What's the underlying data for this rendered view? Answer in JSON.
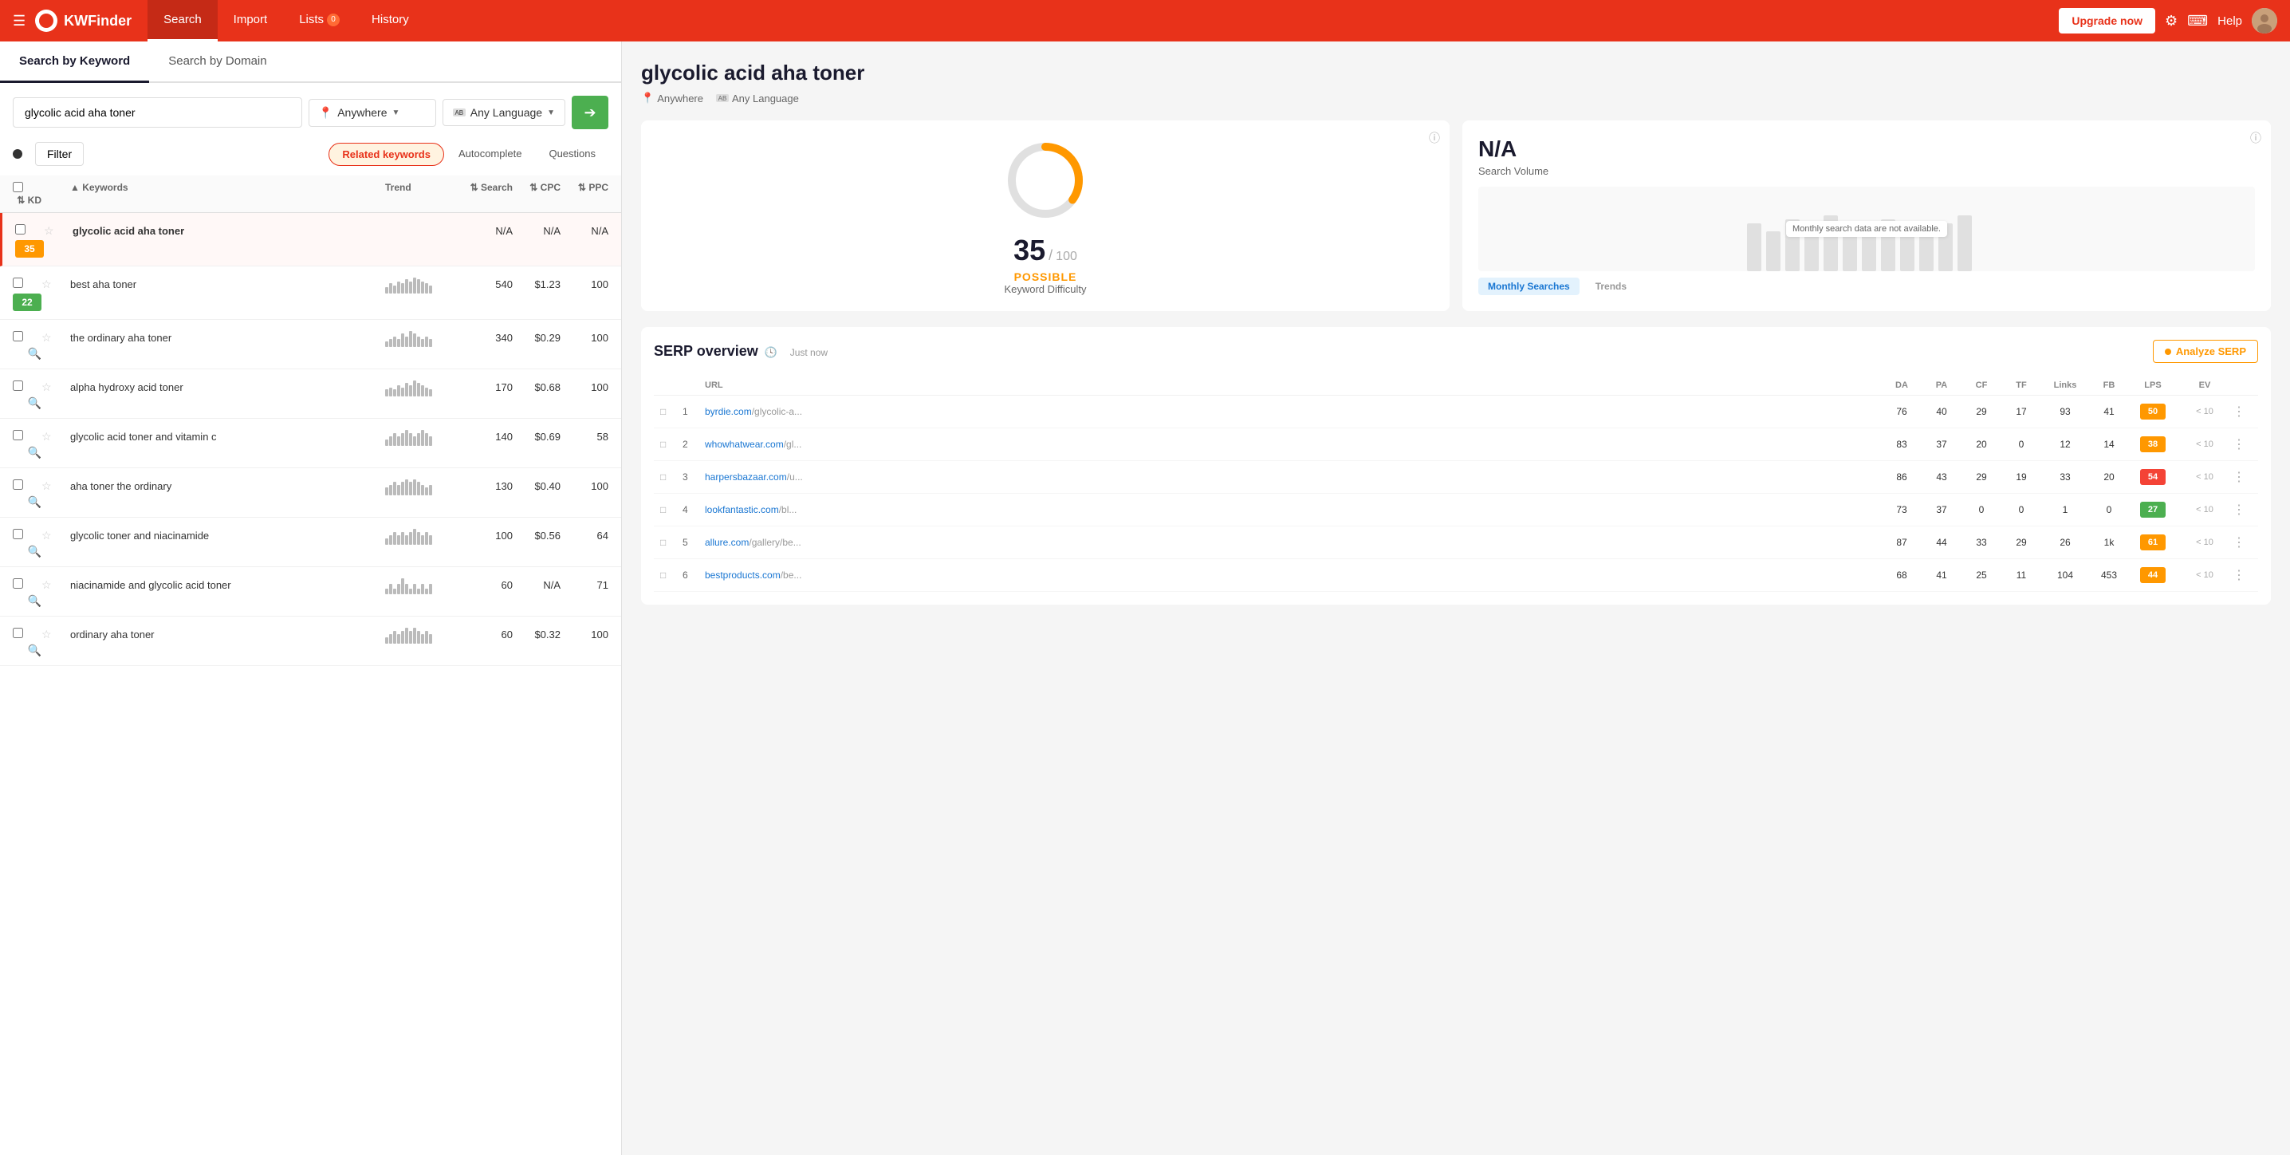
{
  "nav": {
    "logo_text": "KWFinder",
    "tabs": [
      {
        "label": "Search",
        "active": true
      },
      {
        "label": "Import",
        "active": false
      },
      {
        "label": "Lists",
        "badge": "0",
        "active": false
      },
      {
        "label": "History",
        "active": false
      }
    ],
    "upgrade_btn": "Upgrade now",
    "help_label": "Help"
  },
  "left": {
    "search_tab_keyword": "Search by Keyword",
    "search_tab_domain": "Search by Domain",
    "search_value": "glycolic acid aha toner",
    "location_label": "Anywhere",
    "language_label": "Any Language",
    "filter_label": "Filter",
    "kw_tabs": [
      {
        "label": "Related keywords",
        "active": true
      },
      {
        "label": "Autocomplete",
        "active": false
      },
      {
        "label": "Questions",
        "active": false
      }
    ],
    "table_headers": {
      "keyword": "Keywords",
      "trend": "Trend",
      "search": "Search",
      "cpc": "CPC",
      "ppc": "PPC",
      "kd": "KD"
    },
    "keywords": [
      {
        "keyword": "glycolic acid aha toner",
        "bold": true,
        "search": "N/A",
        "cpc": "N/A",
        "ppc": "N/A",
        "kd": 35,
        "kd_color": "orange",
        "selected": true,
        "trend": []
      },
      {
        "keyword": "best aha toner",
        "bold": false,
        "search": "540",
        "cpc": "$1.23",
        "ppc": "100",
        "kd": 22,
        "kd_color": "green",
        "selected": false,
        "trend": [
          3,
          5,
          4,
          6,
          5,
          7,
          6,
          8,
          7,
          6,
          5,
          4
        ]
      },
      {
        "keyword": "the ordinary aha toner",
        "bold": false,
        "search": "340",
        "cpc": "$0.29",
        "ppc": "100",
        "kd": null,
        "kd_color": null,
        "selected": false,
        "trend": [
          2,
          3,
          4,
          3,
          5,
          4,
          6,
          5,
          4,
          3,
          4,
          3
        ]
      },
      {
        "keyword": "alpha hydroxy acid toner",
        "bold": false,
        "search": "170",
        "cpc": "$0.68",
        "ppc": "100",
        "kd": null,
        "kd_color": null,
        "selected": false,
        "trend": [
          3,
          4,
          3,
          5,
          4,
          6,
          5,
          7,
          6,
          5,
          4,
          3
        ]
      },
      {
        "keyword": "glycolic acid toner and vitamin c",
        "bold": false,
        "search": "140",
        "cpc": "$0.69",
        "ppc": "58",
        "kd": null,
        "kd_color": null,
        "selected": false,
        "trend": [
          2,
          3,
          4,
          3,
          4,
          5,
          4,
          3,
          4,
          5,
          4,
          3
        ]
      },
      {
        "keyword": "aha toner the ordinary",
        "bold": false,
        "search": "130",
        "cpc": "$0.40",
        "ppc": "100",
        "kd": null,
        "kd_color": null,
        "selected": false,
        "trend": [
          3,
          4,
          5,
          4,
          5,
          6,
          5,
          6,
          5,
          4,
          3,
          4
        ]
      },
      {
        "keyword": "glycolic toner and niacinamide",
        "bold": false,
        "search": "100",
        "cpc": "$0.56",
        "ppc": "64",
        "kd": null,
        "kd_color": null,
        "selected": false,
        "trend": [
          2,
          3,
          4,
          3,
          4,
          3,
          4,
          5,
          4,
          3,
          4,
          3
        ]
      },
      {
        "keyword": "niacinamide and glycolic acid toner",
        "bold": false,
        "search": "60",
        "cpc": "N/A",
        "ppc": "71",
        "kd": null,
        "kd_color": null,
        "selected": false,
        "trend": [
          1,
          2,
          1,
          2,
          3,
          2,
          1,
          2,
          1,
          2,
          1,
          2
        ]
      },
      {
        "keyword": "ordinary aha toner",
        "bold": false,
        "search": "60",
        "cpc": "$0.32",
        "ppc": "100",
        "kd": null,
        "kd_color": null,
        "selected": false,
        "trend": [
          2,
          3,
          4,
          3,
          4,
          5,
          4,
          5,
          4,
          3,
          4,
          3
        ]
      }
    ]
  },
  "right": {
    "keyword_title": "glycolic acid aha toner",
    "location": "Anywhere",
    "language": "Any Language",
    "kd_value": "35",
    "kd_max": "100",
    "kd_label": "POSSIBLE",
    "kd_sublabel": "Keyword Difficulty",
    "sv_value": "N/A",
    "sv_sublabel": "Search Volume",
    "sv_unavailable": "Monthly search data are not available.",
    "sv_tab_monthly": "Monthly Searches",
    "sv_tab_trends": "Trends",
    "serp_title": "SERP overview",
    "serp_time": "Just now",
    "analyze_btn": "Analyze SERP",
    "serp_headers": [
      "",
      "",
      "URL",
      "DA",
      "PA",
      "CF",
      "TF",
      "Links",
      "FB",
      "LPS",
      "EV",
      ""
    ],
    "serp_rows": [
      {
        "num": 1,
        "url": "byrdie.com",
        "url_path": "/glycolic-a...",
        "da": 76,
        "pa": 40,
        "cf": 29,
        "tf": 17,
        "links": 93,
        "fb": 41,
        "lps": 50,
        "lps_color": "orange",
        "ev": "< 10"
      },
      {
        "num": 2,
        "url": "whowhatwear.com",
        "url_path": "/gl...",
        "da": 83,
        "pa": 37,
        "cf": 20,
        "tf": 0,
        "links": 12,
        "fb": 14,
        "lps": 38,
        "lps_color": "orange",
        "ev": "< 10"
      },
      {
        "num": 3,
        "url": "harpersbazaar.com",
        "url_path": "/u...",
        "da": 86,
        "pa": 43,
        "cf": 29,
        "tf": 19,
        "links": 33,
        "fb": 20,
        "lps": 54,
        "lps_color": "red",
        "ev": "< 10"
      },
      {
        "num": 4,
        "url": "lookfantastic.com",
        "url_path": "/bl...",
        "da": 73,
        "pa": 37,
        "cf": 0,
        "tf": 0,
        "links": 1,
        "fb": 0,
        "lps": 27,
        "lps_color": "green",
        "ev": "< 10"
      },
      {
        "num": 5,
        "url": "allure.com",
        "url_path": "/gallery/be...",
        "da": 87,
        "pa": 44,
        "cf": 33,
        "tf": 29,
        "links": 26,
        "fb": "1k",
        "lps": 61,
        "lps_color": "orange",
        "ev": "< 10"
      },
      {
        "num": 6,
        "url": "bestproducts.com",
        "url_path": "/be...",
        "da": 68,
        "pa": 41,
        "cf": 25,
        "tf": 11,
        "links": 104,
        "fb": 453,
        "lps": 44,
        "lps_color": "orange",
        "ev": "< 10"
      }
    ]
  }
}
